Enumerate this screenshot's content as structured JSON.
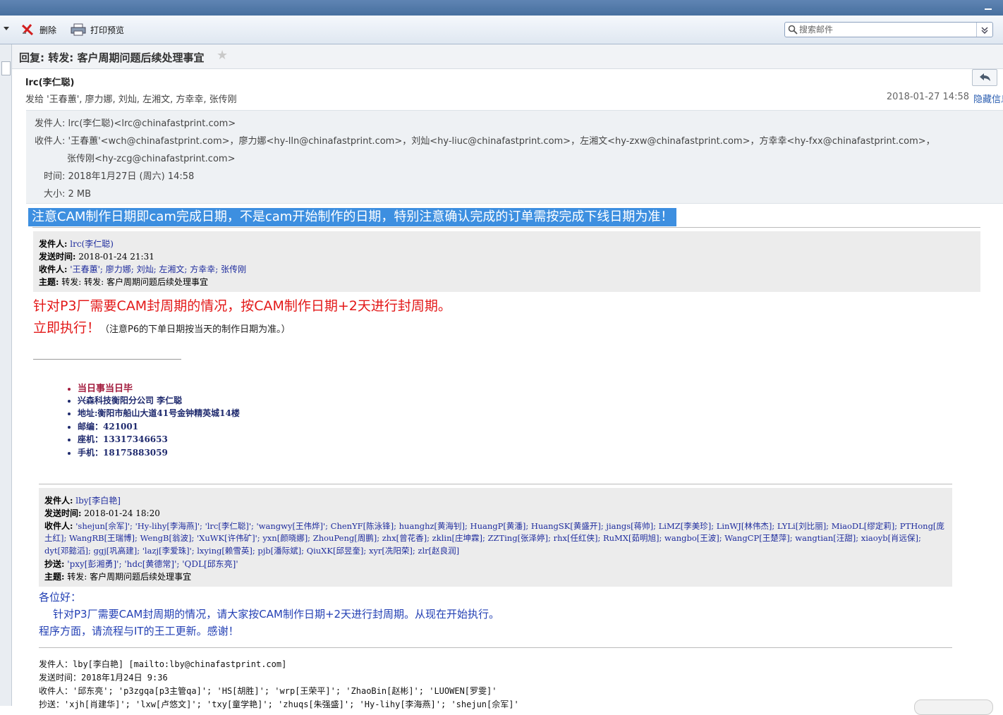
{
  "toolbar": {
    "delete_label": "删除",
    "print_label": "打印预览",
    "search_placeholder": "搜索邮件"
  },
  "message": {
    "subject": "回复: 转发: 客户周期问题后续处理事宜",
    "sender": "lrc(李仁聪)",
    "to_line": "发给 '王春蕙', 廖力娜, 刘灿, 左湘文, 方幸幸, 张传刚",
    "date": "2018-01-27 14:58",
    "hide_link": "隐藏信息",
    "header": {
      "from": "发件人: lrc(李仁聪)<lrc@chinafastprint.com>",
      "to1": "收件人: '王春蕙'<wch@chinafastprint.com>，廖力娜<hy-lln@chinafastprint.com>，刘灿<hy-liuc@chinafastprint.com>，左湘文<hy-zxw@chinafastprint.com>，方幸幸<hy-fxx@chinafastprint.com>，",
      "to2": "张传刚<hy-zcg@chinafastprint.com>",
      "time": "时间: 2018年1月27日 (周六) 14:58",
      "size": "大小: 2 MB"
    }
  },
  "body": {
    "highlight": "注意CAM制作日期即cam完成日期，不是cam开始制作的日期，特别注意确认完成的订单需按完成下线日期为准！",
    "q1": {
      "from_k": "发件人:",
      "from_v": "lrc(李仁聪)",
      "time_k": "发送时间:",
      "time_v": "2018-01-24 21:31",
      "to_k": "收件人:",
      "to_v": "'王春蕙'; 廖力娜; 刘灿; 左湘文; 方幸幸; 张传刚",
      "subj_k": "主题:",
      "subj_v": "转发: 转发: 客户周期问题后续处理事宜"
    },
    "red1": "针对P3厂需要CAM封周期的情况，按CAM制作日期+2天进行封周期。",
    "red2": "立即执行！",
    "note": "（注意P6的下单日期按当天的制作日期为准。）",
    "signature": [
      "当日事当日毕",
      "兴森科技衡阳分公司 李仁聪",
      "地址:衡阳市船山大道41号金钟精英城14楼",
      "邮编：421001",
      "座机：13317346653",
      "手机：18175883059"
    ],
    "q2": {
      "from_k": "发件人:",
      "from_v": "lby[李白艳]",
      "time_k": "发送时间:",
      "time_v": "2018-01-24 18:20",
      "to_k": "收件人:",
      "to_v1": "'shejun[佘军]'; 'Hy-lihy[李海燕]'; 'lrc[李仁聪]'; 'wangwy[王伟烨]'; ChenYF[陈泳锋]; huanghz[黄海钊]; HuangP[黄潘]; HuangSK[黄盛开]; jiangs[蒋帅]; LiMZ[李美珍]; LinWJ[林伟杰]; LYLi[刘比丽]; MiaoDL[缪定莉]; PTHong[庞",
      "to_v2": "土红]; WangRB[王瑞博]; WengB[翁波]; 'XuWK[许伟矿]'; yxn[颜晓娜]; ZhouPeng[周鹏]; zhx[曾花香]; zklin[庄坤霖]; ZZTing[张泽婷]; rhx[任红侠]; RuMX[茹明旭]; wangbo[王波]; WangCP[王楚萍]; wangtian[汪甜]; xiaoyb[肖远保];",
      "to_v3": "dyt[邓懿滔]; ggj[巩高建]; 'lazj[李爱珠]'; lxying[赖雪英]; pjb[潘际斌]; QiuXK[邱昱奎]; xyr[冼阳荣]; zlr[赵良润]",
      "cc_k": "抄送:",
      "cc_v": "'pxy[彭湘勇]'; 'hdc[黄德常]'; 'QDL[邱东亮]'",
      "subj_k": "主题:",
      "subj_v": "转发: 客户周期问题后续处理事宜"
    },
    "greeting": "各位好：",
    "line1": "针对P3厂需要CAM封周期的情况，请大家按CAM制作日期+2天进行封周期。从现在开始执行。",
    "line2": "程序方面，请流程与IT的王工更新。感谢！",
    "q3": {
      "from": "发件人：lby[李白艳] [mailto:lby@chinafastprint.com]",
      "time": "发送时间：2018年1月24日 9:36",
      "to": "收件人：'邱东亮'; 'p3zgqa[p3主管qa]'; 'HS[胡胜]'; 'wrp[王荣平]'; 'ZhaoBin[赵彬]'; 'LUOWEN[罗雯]'",
      "cc": "抄送：'xjh[肖建华]'; 'lxw[卢悠文]'; 'txy[童学艳]'; 'zhuqs[朱强盛]'; 'Hy-lihy[李海燕]'; 'shejun[佘军]'"
    }
  }
}
